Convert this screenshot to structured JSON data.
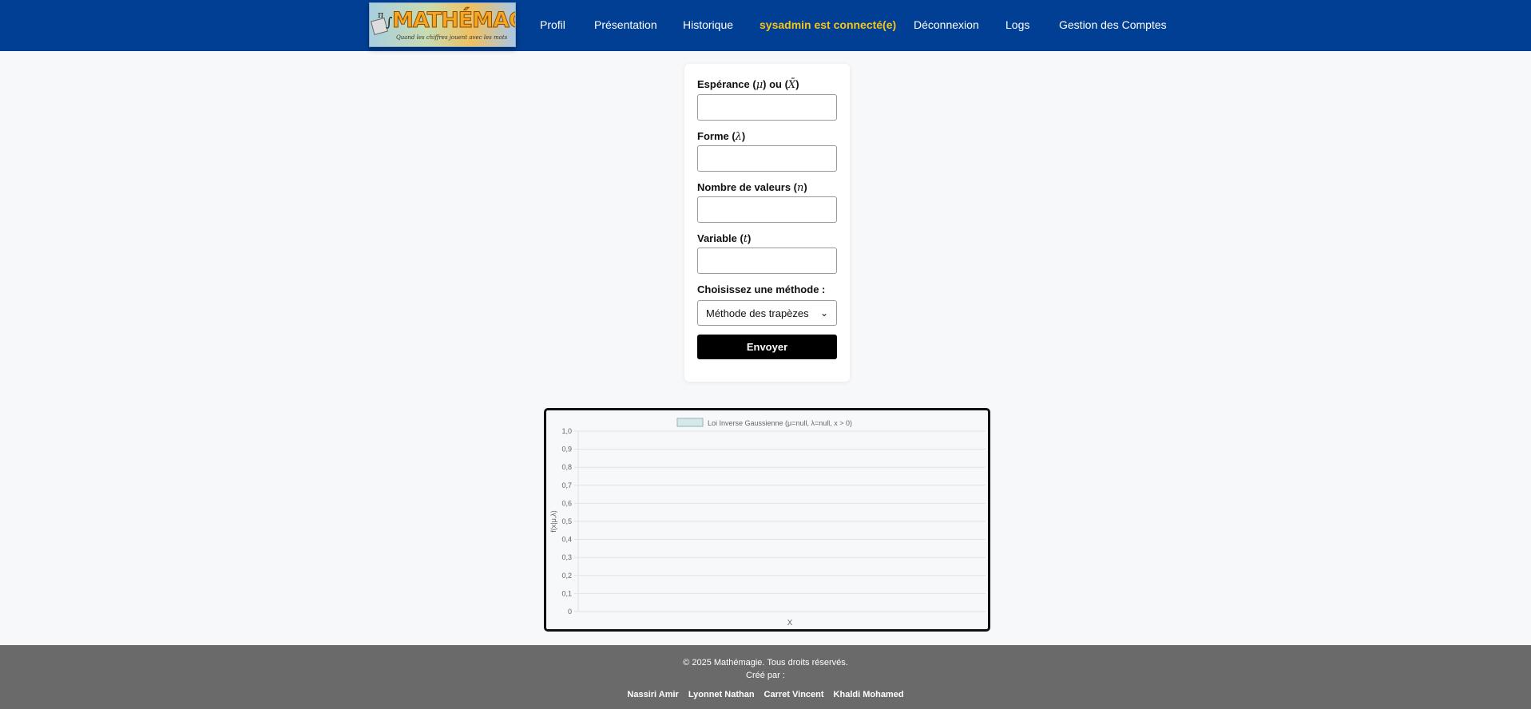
{
  "header": {
    "logo": {
      "title": "MATHÉMAGIE",
      "subtitle": "Quand les chiffres jouent avec les mots",
      "pi_symbol": "π",
      "integral_symbol": "∫"
    },
    "nav": [
      {
        "label": "Profil"
      },
      {
        "label": "Présentation"
      },
      {
        "label": "Historique"
      },
      {
        "label": "sysadmin est connecté(e)"
      },
      {
        "label": "Déconnexion"
      },
      {
        "label": "Logs"
      },
      {
        "label": "Gestion des Comptes"
      }
    ],
    "colors": {
      "background": "#013f94",
      "user_highlight": "#f5c518"
    }
  },
  "form": {
    "fields": [
      {
        "label_prefix": "Espérance (",
        "symbol": "μ",
        "label_mid": ") ou (",
        "symbol2": "X̄",
        "label_suffix": ")",
        "value": ""
      },
      {
        "label_prefix": "Forme (",
        "symbol": "λ",
        "label_suffix": ")",
        "value": ""
      },
      {
        "label_prefix": "Nombre de valeurs (",
        "symbol": "n",
        "label_suffix": ")",
        "value": ""
      },
      {
        "label_prefix": "Variable (",
        "symbol": "t",
        "label_suffix": ")",
        "value": ""
      }
    ],
    "method_label": "Choisissez une méthode :",
    "method_selected": "Méthode des trapèzes",
    "submit_label": "Envoyer"
  },
  "chart_data": {
    "type": "line",
    "series": [
      {
        "name": "Loi Inverse Gaussienne (μ=null, λ=null, x > 0)",
        "values": []
      }
    ],
    "x": [],
    "xlabel": "X",
    "ylabel": "f(x|μ,λ)",
    "ylim": [
      0,
      1
    ],
    "yticks": [
      "0",
      "0,1",
      "0,2",
      "0,3",
      "0,4",
      "0,5",
      "0,6",
      "0,7",
      "0,8",
      "0,9",
      "1,0"
    ],
    "grid": true,
    "legend": "top-center"
  },
  "footer": {
    "copyright": "© 2025 Mathémagie. Tous droits réservés.",
    "created_by": "Créé par :",
    "authors": [
      "Nassiri Amir",
      "Lyonnet Nathan",
      "Carret Vincent",
      "Khaldi Mohamed"
    ],
    "colors": {
      "background": "#6a6a6a"
    }
  }
}
